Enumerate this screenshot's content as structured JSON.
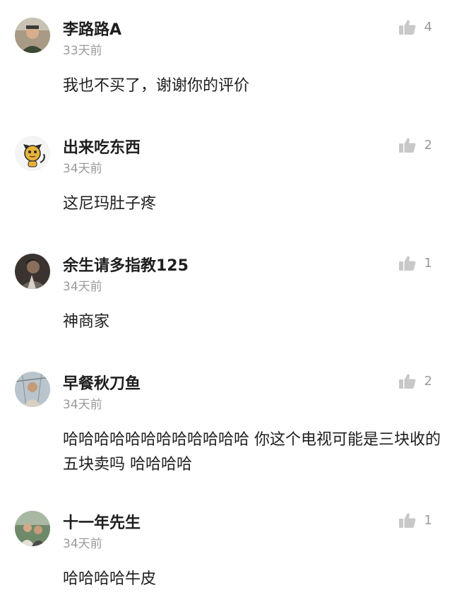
{
  "comments": [
    {
      "username": "李路路A",
      "time": "33天前",
      "text": "我也不买了，谢谢你的评价",
      "likes": "4",
      "avatar_icon": "user-avatar-icon"
    },
    {
      "username": "出来吃东西",
      "time": "34天前",
      "text": "这尼玛肚子疼",
      "likes": "2",
      "avatar_icon": "cat-avatar-icon"
    },
    {
      "username": "余生请多指教125",
      "time": "34天前",
      "text": "神商家",
      "likes": "1",
      "avatar_icon": "user-avatar-icon"
    },
    {
      "username": "早餐秋刀鱼",
      "time": "34天前",
      "text": "哈哈哈哈哈哈哈哈哈哈哈哈 你这个电视可能是三块收的 五块卖吗 哈哈哈哈",
      "likes": "2",
      "avatar_icon": "user-avatar-icon"
    },
    {
      "username": "十一年先生",
      "time": "34天前",
      "text": "哈哈哈哈牛皮",
      "likes": "1",
      "avatar_icon": "user-avatar-icon"
    }
  ],
  "like_icon": "thumbs-up-icon"
}
